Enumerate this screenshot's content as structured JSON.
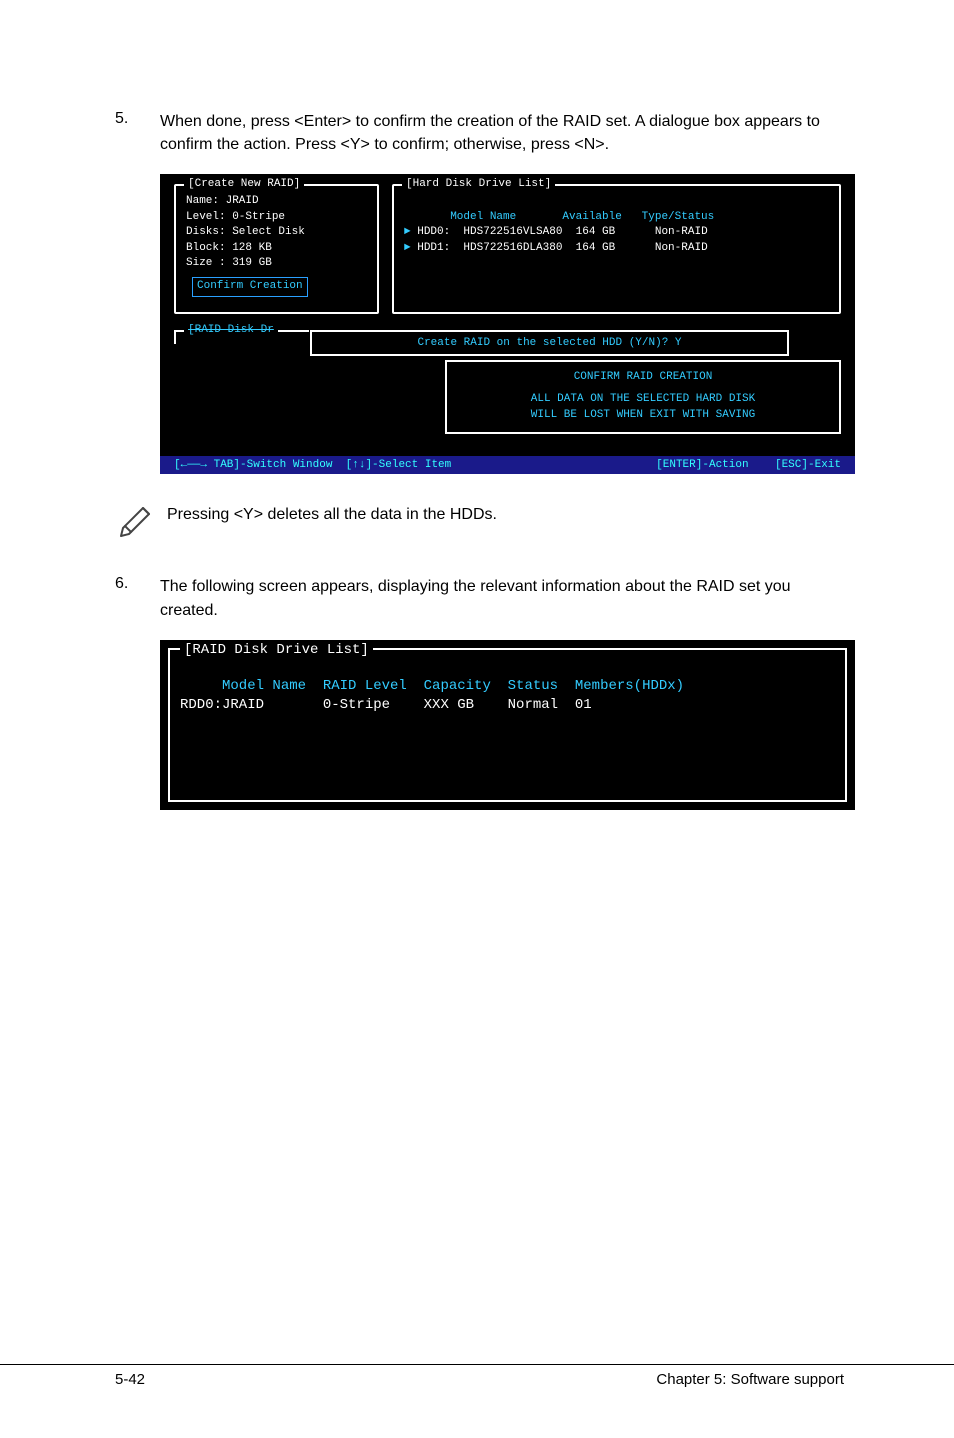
{
  "step5": {
    "num": "5.",
    "text": "When done, press <Enter> to confirm the creation of the RAID set. A dialogue box appears to confirm the action. Press <Y> to confirm; otherwise, press <N>."
  },
  "term1": {
    "create_title": "[Create New RAID]",
    "create_lines": {
      "l1": "Name: JRAID",
      "l2": "Level: 0-Stripe",
      "l3": "Disks: Select Disk",
      "l4": "Block: 128 KB",
      "l5": "Size : 319 GB"
    },
    "confirm_creation": "Confirm Creation",
    "hdd_title": "[Hard Disk Drive List]",
    "hdd_header": "       Model Name       Available   Type/Status",
    "hdd_row1": "HDD0:  HDS722516VLSA80  164 GB      Non-RAID",
    "hdd_row2": "HDD1:  HDS722516DLA380  164 GB      Non-RAID",
    "raid_disk_label": "[RAID Disk Dr",
    "dialog": "Create RAID on the selected HDD (Y/N)? Y",
    "confirm_box": {
      "l1": "CONFIRM RAID CREATION",
      "l2": "ALL DATA ON THE SELECTED HARD DISK",
      "l3": "WILL BE LOST WHEN EXIT WITH SAVING"
    },
    "help": {
      "h1": "[←――→ TAB]-Switch Window  ",
      "h2": "[↑↓]-Select Item",
      "h3": "[ENTER]-Action",
      "h4": "[ESC]-Exit"
    }
  },
  "note": "Pressing <Y> deletes all the data in the HDDs.",
  "step6": {
    "num": "6.",
    "text": "The following screen appears, displaying the relevant information about the RAID set you created."
  },
  "term2": {
    "title": "[RAID Disk Drive List]",
    "header": "     Model Name  RAID Level  Capacity  Status  Members(HDDx)",
    "row1": "RDD0:JRAID       0-Stripe    XXX GB    Normal  01"
  },
  "footer": {
    "left": "5-42",
    "right": "Chapter 5: Software support"
  }
}
